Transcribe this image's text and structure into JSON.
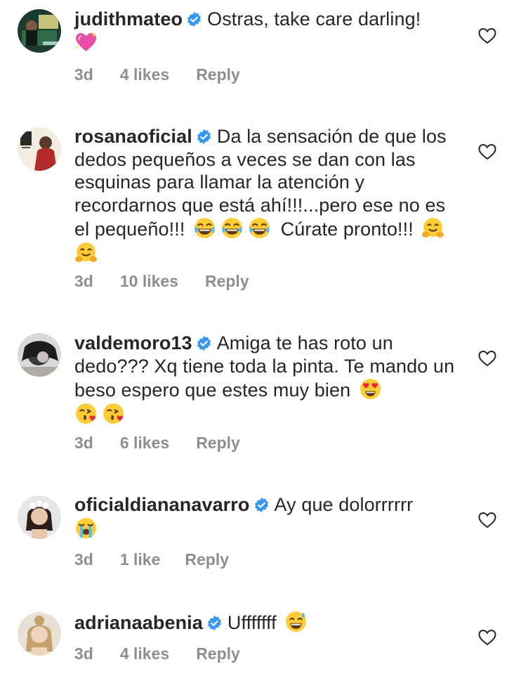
{
  "comments": [
    {
      "username": "judithmateo",
      "text": "Ostras, take care darling!",
      "emoji_after": [
        "sparkling-heart"
      ],
      "time": "3d",
      "likes": "4 likes",
      "reply": "Reply"
    },
    {
      "username": "rosanaoficial",
      "text": "Da la sensación de que los dedos pequeños a veces se dan con las esquinas para llamar la atención y recordarnos que está ahí!!!...pero ese no es el pequeño!!!",
      "emoji_mid": [
        "tears-of-joy",
        "tears-of-joy",
        "tears-of-joy"
      ],
      "text2": "Cúrate pronto!!!",
      "emoji_after": [
        "hugging-face",
        "hugging-face"
      ],
      "time": "3d",
      "likes": "10 likes",
      "reply": "Reply"
    },
    {
      "username": "valdemoro13",
      "text": "Amiga te has roto un dedo??? Xq tiene toda la pinta. Te mando un beso espero que estes muy bien",
      "emoji_after": [
        "heart-eyes",
        "kissing-heart",
        "kissing-heart"
      ],
      "time": "3d",
      "likes": "6 likes",
      "reply": "Reply"
    },
    {
      "username": "oficialdiananavarro",
      "text": "Ay que dolorrrrrr",
      "emoji_after": [
        "loudly-crying"
      ],
      "time": "3d",
      "likes": "1 like",
      "reply": "Reply"
    },
    {
      "username": "adrianaabenia",
      "text": "Ufffffff",
      "emoji_after": [
        "grinning-sweat"
      ],
      "time": "3d",
      "likes": "4 likes",
      "reply": "Reply"
    }
  ],
  "icons": {
    "verified_badge": "verified-badge-icon",
    "like": "heart-outline-icon"
  },
  "colors": {
    "verified": "#3897f0",
    "meta_text": "#8e8e8e",
    "body_text": "#262626"
  }
}
